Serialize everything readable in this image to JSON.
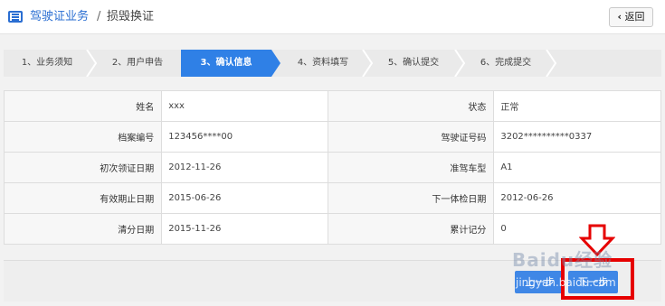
{
  "header": {
    "section": "驾驶证业务",
    "separator": "/",
    "page": "损毁换证",
    "back_label": "返回"
  },
  "steps": [
    {
      "label": "1、业务须知",
      "active": false
    },
    {
      "label": "2、用户申告",
      "active": false
    },
    {
      "label": "3、确认信息",
      "active": true
    },
    {
      "label": "4、资料填写",
      "active": false
    },
    {
      "label": "5、确认提交",
      "active": false
    },
    {
      "label": "6、完成提交",
      "active": false
    }
  ],
  "info": {
    "rows": [
      {
        "l1": "姓名",
        "v1": "xxx",
        "l2": "状态",
        "v2": "正常"
      },
      {
        "l1": "档案编号",
        "v1": "123456****00",
        "l2": "驾驶证号码",
        "v2": "3202**********0337"
      },
      {
        "l1": "初次领证日期",
        "v1": "2012-11-26",
        "l2": "准驾车型",
        "v2": "A1"
      },
      {
        "l1": "有效期止日期",
        "v1": "2015-06-26",
        "l2": "下一体检日期",
        "v2": "2012-06-26"
      },
      {
        "l1": "清分日期",
        "v1": "2015-11-26",
        "l2": "累计记分",
        "v2": "0"
      }
    ]
  },
  "footer": {
    "prev_label": "上一步",
    "next_label": "下一步"
  },
  "watermark": {
    "logo": "Baidu经验",
    "url": "jingyan.baidu.com"
  },
  "colors": {
    "accent": "#2f80e6",
    "highlight": "#e60000"
  }
}
